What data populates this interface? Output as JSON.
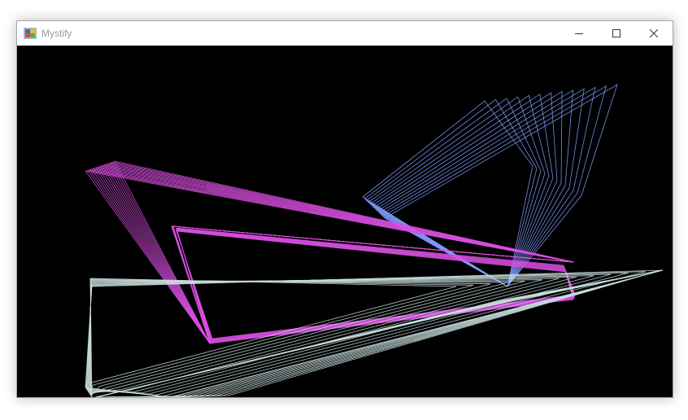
{
  "window": {
    "title": "Mystify"
  },
  "icons": {
    "app": "mystify-app-icon",
    "minimize": "minimize-icon",
    "maximize": "maximize-icon",
    "close": "close-icon"
  },
  "colors": {
    "background": "#000000",
    "blue_polygon": "#7f9cff",
    "magenta_polygon": "#d84fe0",
    "white_polygon": "#c8dcdc"
  }
}
